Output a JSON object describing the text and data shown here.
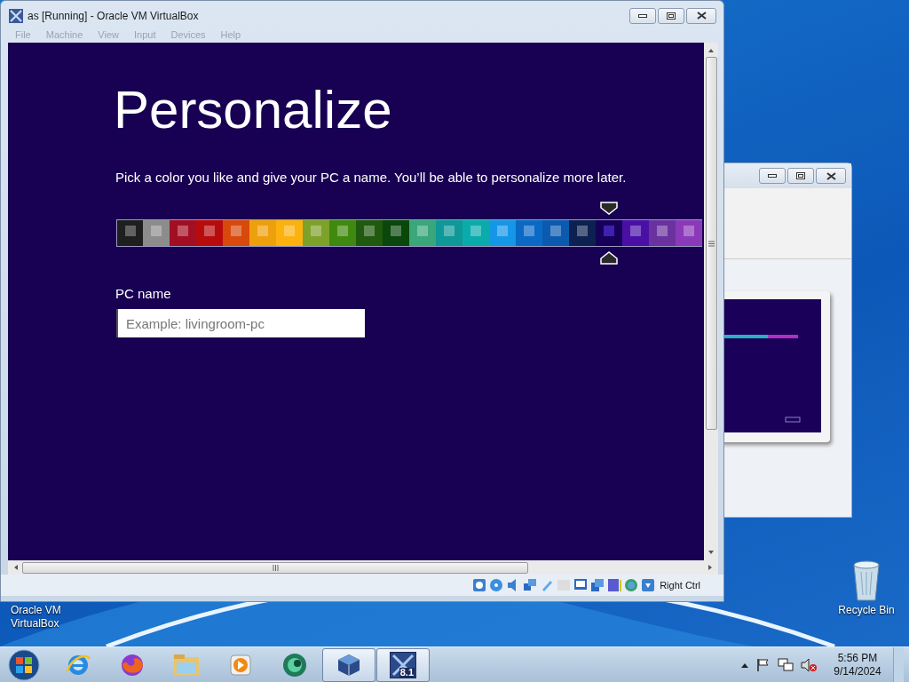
{
  "host_window": {
    "title": "as [Running] - Oracle VM VirtualBox",
    "menu": [
      {
        "label": "File",
        "disabled": true
      },
      {
        "label": "Machine",
        "disabled": true
      },
      {
        "label": "View",
        "disabled": true
      },
      {
        "label": "Input",
        "disabled": true
      },
      {
        "label": "Devices",
        "disabled": true
      },
      {
        "label": "Help",
        "disabled": true
      }
    ],
    "host_key": "Right Ctrl"
  },
  "guest_screen": {
    "heading": "Personalize",
    "instructions": "Pick a color you like and give your PC a name. You’ll be able to personalize more later.",
    "swatches": [
      {
        "color": "#1f1f1f",
        "selected": false
      },
      {
        "color": "#8c8c8c",
        "selected": false
      },
      {
        "color": "#a30f22",
        "selected": false
      },
      {
        "color": "#b80c0c",
        "selected": false
      },
      {
        "color": "#d84a0c",
        "selected": false
      },
      {
        "color": "#ee9f0c",
        "selected": false
      },
      {
        "color": "#fbb20f",
        "selected": false
      },
      {
        "color": "#7ea12a",
        "selected": false
      },
      {
        "color": "#3f8a0e",
        "selected": false
      },
      {
        "color": "#1f5a0e",
        "selected": false
      },
      {
        "color": "#0a470a",
        "selected": false
      },
      {
        "color": "#3aa77a",
        "selected": false
      },
      {
        "color": "#0e9898",
        "selected": false
      },
      {
        "color": "#0aabab",
        "selected": false
      },
      {
        "color": "#1597e8",
        "selected": false
      },
      {
        "color": "#0b69c6",
        "selected": false
      },
      {
        "color": "#0b5ab0",
        "selected": false
      },
      {
        "color": "#0c2150",
        "selected": false
      },
      {
        "color": "#170058",
        "selected": true
      },
      {
        "color": "#4a10a6",
        "selected": false
      },
      {
        "color": "#6a329e",
        "selected": false
      },
      {
        "color": "#8a3ab8",
        "selected": false
      }
    ],
    "pc_name": {
      "label": "PC name",
      "placeholder": "Example: livingroom-pc"
    }
  },
  "desktop_icons": [
    {
      "lines": [
        "Oracle VM",
        "VirtualBox"
      ]
    },
    {
      "kind": "recycle-bin",
      "lines": [
        "Recycle Bin"
      ]
    }
  ],
  "taskbar": {
    "apps": [
      {
        "kind": "ie",
        "open": false
      },
      {
        "kind": "firefox",
        "open": false
      },
      {
        "kind": "explorer",
        "open": false
      },
      {
        "kind": "media",
        "open": false
      },
      {
        "kind": "green-app",
        "open": false
      },
      {
        "kind": "virtualbox",
        "open": true
      },
      {
        "kind": "vm81",
        "open": true,
        "badge": "8.1"
      }
    ],
    "clock": {
      "time": "5:56 PM",
      "date": "9/14/2024"
    }
  }
}
